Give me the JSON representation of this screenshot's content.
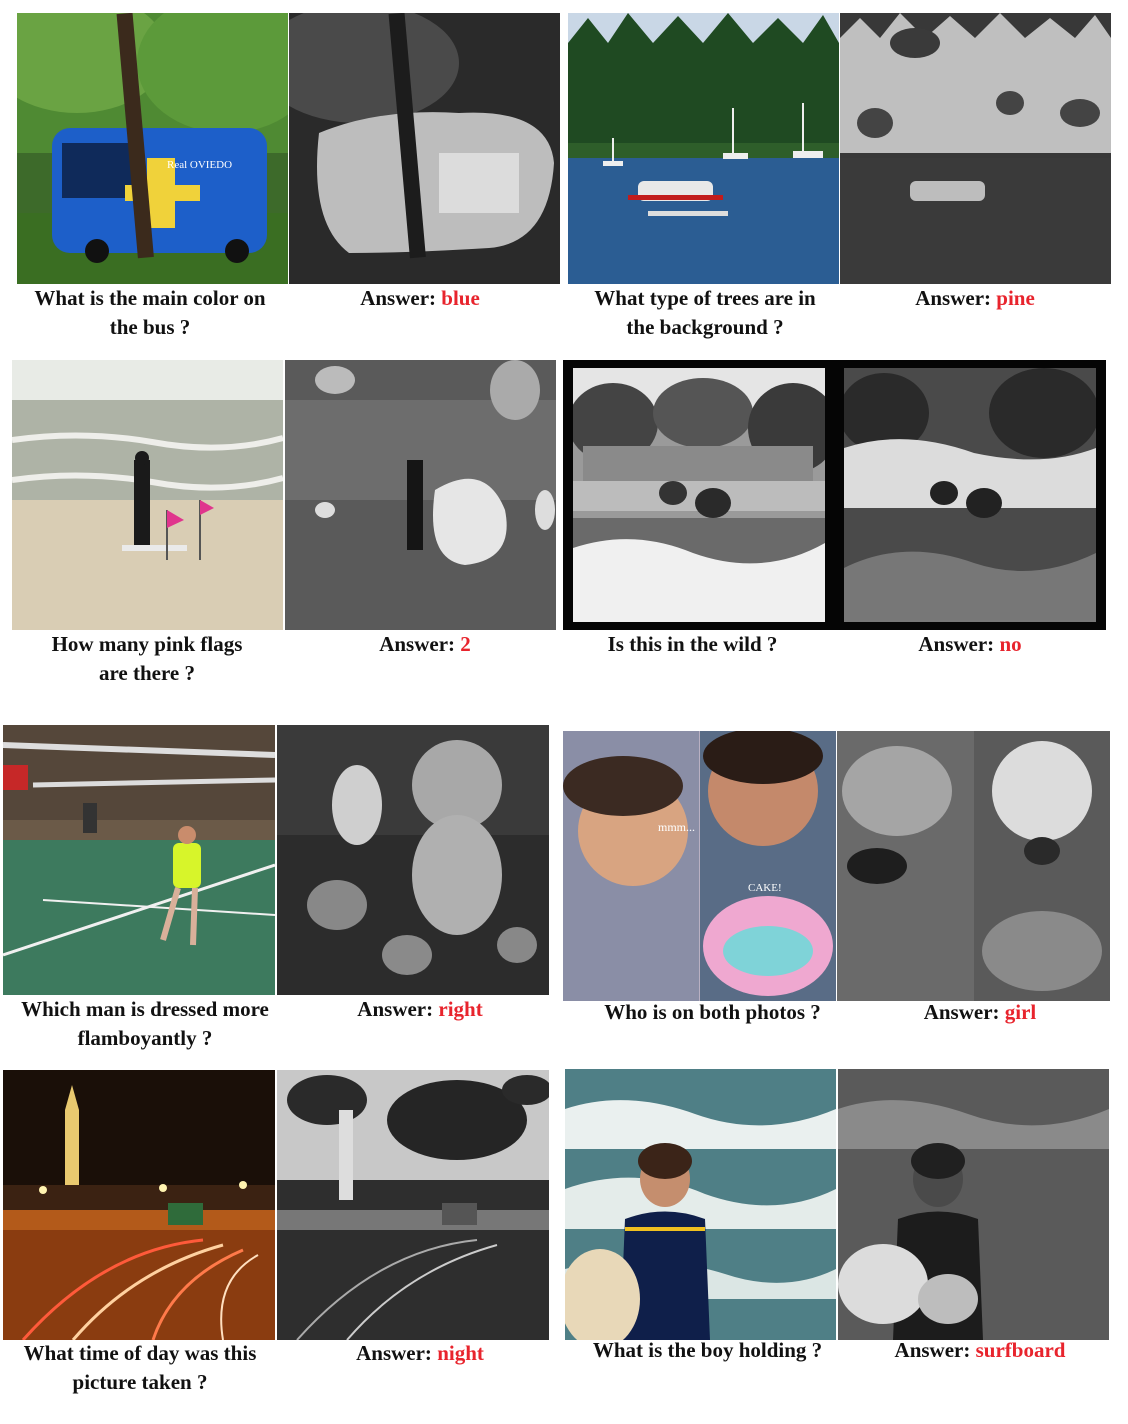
{
  "answer_label": "Answer:",
  "panels": [
    {
      "question_lines": [
        "What is the main color on",
        "the bus ?"
      ],
      "answer": "blue"
    },
    {
      "question_lines": [
        "What type of trees are in",
        "the background ?"
      ],
      "answer": "pine"
    },
    {
      "question_lines": [
        "How many pink flags",
        "are there ?"
      ],
      "answer": "2"
    },
    {
      "question_lines": [
        "Is this in the wild ?"
      ],
      "answer": "no"
    },
    {
      "question_lines": [
        "Which man is dressed more",
        "flamboyantly ?"
      ],
      "answer": "right"
    },
    {
      "question_lines": [
        "Who is on both photos ?"
      ],
      "answer": "girl"
    },
    {
      "question_lines": [
        "What time of day was this",
        "picture taken ?"
      ],
      "answer": "night"
    },
    {
      "question_lines": [
        "What is the boy holding ?"
      ],
      "answer": "surfboard"
    }
  ],
  "image_text": {
    "bus_logo": "Real OVIEDO",
    "baby_mmm": "mmm...",
    "baby_cake": "CAKE!"
  },
  "colors": {
    "answer_accent": "#e8242d"
  }
}
